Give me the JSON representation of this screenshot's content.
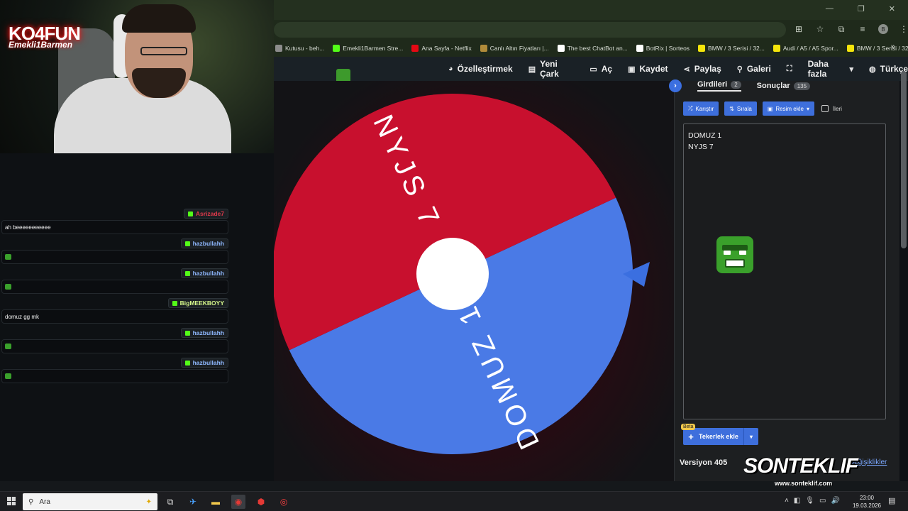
{
  "browser": {
    "bookmarks": [
      {
        "label": "Kutusu - beh...",
        "color": "#8c8c8c"
      },
      {
        "label": "Emekli1Barmen Stre...",
        "color": "#53fc18"
      },
      {
        "label": "Ana Sayfa - Netflix",
        "color": "#e50914"
      },
      {
        "label": "Canlı Altın Fiyatları |...",
        "color": "#b08b3a"
      },
      {
        "label": "The best ChatBot an...",
        "color": "#ffffff"
      },
      {
        "label": "BotRix | Sorteos",
        "color": "#ffffff"
      },
      {
        "label": "BMW / 3 Serisi / 32...",
        "color": "#f5e50b"
      },
      {
        "label": "Audi / A5 / A5 Spor...",
        "color": "#f5e50b"
      },
      {
        "label": "BMW / 3 Serisi / 32...",
        "color": "#f5e50b"
      }
    ],
    "bookmarks_more": "»",
    "profile_initial": "B"
  },
  "site_menu": [
    {
      "icon": "palette-icon",
      "glyph": "◕",
      "label": "Özelleştirmek"
    },
    {
      "icon": "new-file-icon",
      "glyph": "▤",
      "label": "Yeni Çark"
    },
    {
      "icon": "folder-open-icon",
      "glyph": "▭",
      "label": "Aç"
    },
    {
      "icon": "save-icon",
      "glyph": "▣",
      "label": "Kaydet"
    },
    {
      "icon": "share-icon",
      "glyph": "⋖",
      "label": "Paylaş"
    },
    {
      "icon": "search-icon",
      "glyph": "⚲",
      "label": "Galeri"
    },
    {
      "icon": "fullscreen-icon",
      "glyph": "⛶",
      "label": ""
    },
    {
      "icon": "chevron-down-icon",
      "glyph": "▾",
      "label": "Daha fazla"
    },
    {
      "icon": "globe-icon",
      "glyph": "◍",
      "label": "Türkçe"
    }
  ],
  "wheel": {
    "segments": [
      {
        "label": "DOMUZ 1",
        "color": "#4a7ae6",
        "share": 0.5
      },
      {
        "label": "NYJS 7",
        "color": "#c8102e",
        "share": 0.5
      }
    ],
    "rotation_deg": -25,
    "pointer_color": "#3b6fe0"
  },
  "panel": {
    "tabs": [
      {
        "label": "Girdileri",
        "count": "2",
        "active": true
      },
      {
        "label": "Sonuçlar",
        "count": "135",
        "active": false
      }
    ],
    "buttons": {
      "shuffle": "Karıştır",
      "sort": "Sırala",
      "add_image": "Resim ekle",
      "advanced": "İleri"
    },
    "entries": [
      "DOMUZ 1",
      "NYJS 7"
    ],
    "add_wheel": "Tekerlek ekle",
    "beta": "Beta",
    "version": "Versiyon 405",
    "changes": "Değişiklikler"
  },
  "overlay": {
    "logo_line1": "KO4FUN",
    "logo_line2": "Emekli1Barmen",
    "watermark": "SONTEKLIF",
    "watermark_url": "www.sonteklif.com"
  },
  "chat": [
    {
      "user": "Asrizade7",
      "user_color": "#e0394b",
      "message": "ah beeeeeeeeeee",
      "emote": false
    },
    {
      "user": "hazbullahh",
      "user_color": "#8fb8ff",
      "message": "",
      "emote": true
    },
    {
      "user": "hazbullahh",
      "user_color": "#8fb8ff",
      "message": "",
      "emote": true
    },
    {
      "user": "BigMEEKBOYY",
      "user_color": "#d4f58a",
      "message": "domuz gg mk",
      "emote": false
    },
    {
      "user": "hazbullahh",
      "user_color": "#8fb8ff",
      "message": "",
      "emote": true
    },
    {
      "user": "hazbullahh",
      "user_color": "#8fb8ff",
      "message": "",
      "emote": true
    }
  ],
  "taskbar": {
    "search_placeholder": "Ara",
    "time": "23:00",
    "date": "19.03.2026"
  }
}
